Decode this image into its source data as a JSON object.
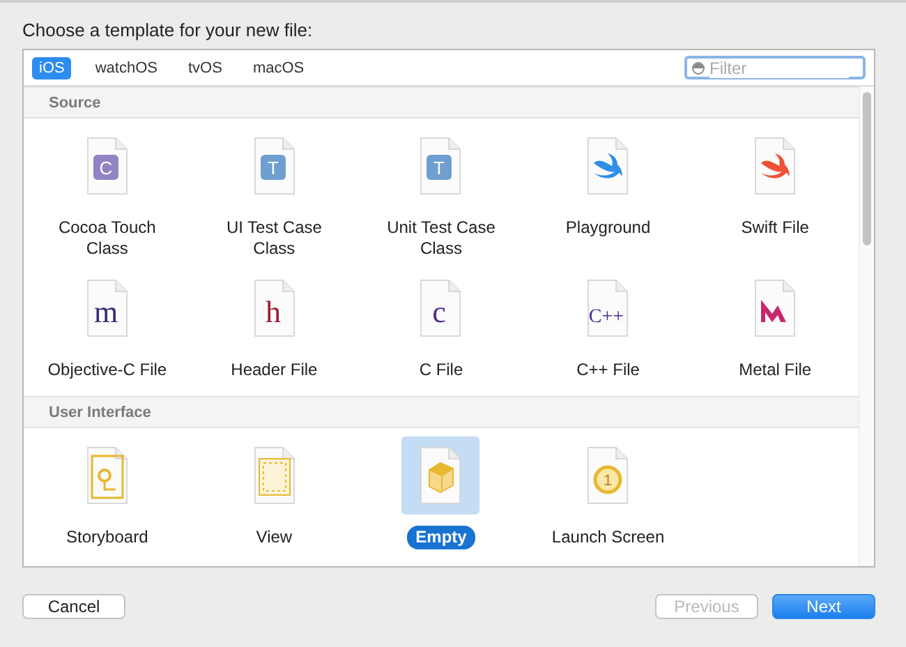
{
  "heading": "Choose a template for your new file:",
  "tabs": [
    {
      "label": "iOS",
      "selected": true
    },
    {
      "label": "watchOS",
      "selected": false
    },
    {
      "label": "tvOS",
      "selected": false
    },
    {
      "label": "macOS",
      "selected": false
    }
  ],
  "filter": {
    "placeholder": "Filter"
  },
  "sections": [
    {
      "title": "Source",
      "items": [
        {
          "label": "Cocoa Touch Class",
          "kind": "badge",
          "glyph": "C",
          "color": "#9283c4",
          "selected": false
        },
        {
          "label": "UI Test Case Class",
          "kind": "badge",
          "glyph": "T",
          "color": "#6e9fd0",
          "selected": false
        },
        {
          "label": "Unit Test Case Class",
          "kind": "badge",
          "glyph": "T",
          "color": "#6e9fd0",
          "selected": false
        },
        {
          "label": "Playground",
          "kind": "swift",
          "color": "#2f8fe8",
          "selected": false
        },
        {
          "label": "Swift File",
          "kind": "swift",
          "color": "#f05138",
          "selected": false
        },
        {
          "label": "Objective-C File",
          "kind": "letter",
          "glyph": "m",
          "color": "#3c2a7a",
          "selected": false
        },
        {
          "label": "Header File",
          "kind": "letter",
          "glyph": "h",
          "color": "#9b1b30",
          "selected": false
        },
        {
          "label": "C File",
          "kind": "letter",
          "glyph": "c",
          "color": "#4a2a8a",
          "selected": false
        },
        {
          "label": "C++ File",
          "kind": "letter",
          "glyph": "C++",
          "color": "#4a2a8a",
          "selected": false
        },
        {
          "label": "Metal File",
          "kind": "metal",
          "color": "#c8286e",
          "selected": false
        }
      ]
    },
    {
      "title": "User Interface",
      "items": [
        {
          "label": "Storyboard",
          "kind": "storyboard",
          "color": "#e8b830",
          "selected": false
        },
        {
          "label": "View",
          "kind": "view",
          "color": "#e8b830",
          "selected": false
        },
        {
          "label": "Empty",
          "kind": "cube",
          "color": "#e8b830",
          "selected": true
        },
        {
          "label": "Launch Screen",
          "kind": "launch",
          "glyph": "1",
          "color": "#e8b830",
          "selected": false
        }
      ]
    }
  ],
  "buttons": [
    {
      "label": "Cancel",
      "kind": "normal",
      "disabled": false
    },
    {
      "label": "Previous",
      "kind": "normal",
      "disabled": true
    },
    {
      "label": "Next",
      "kind": "default",
      "disabled": false
    }
  ]
}
